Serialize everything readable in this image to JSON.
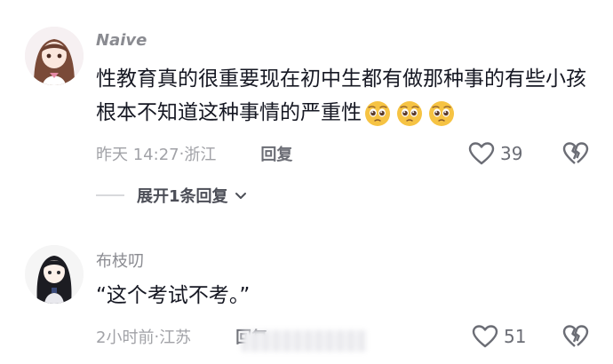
{
  "comments": [
    {
      "username": "Naive",
      "text": "性教育真的很重要现在初中生都有做那种事的有些小孩根本不知道这种事情的严重性",
      "emoji_count": 3,
      "emoji_name": "pleading-face",
      "time": "昨天 14:27",
      "location": "浙江",
      "reply_label": "回复",
      "likes": "39",
      "expand_label": "展开1条回复"
    },
    {
      "username": "布枝叨",
      "text": "“这个考试不考。”",
      "time": "2小时前",
      "location": "江苏",
      "reply_label": "回复",
      "likes": "51"
    }
  ],
  "separator": " · ",
  "icons": {
    "like": "heart-outline-icon",
    "dislike": "broken-heart-icon",
    "expand": "chevron-down-icon"
  },
  "colors": {
    "text": "#161823",
    "muted": "#a1a2a7",
    "username": "#8a8b91",
    "emoji": "#f6c343"
  }
}
